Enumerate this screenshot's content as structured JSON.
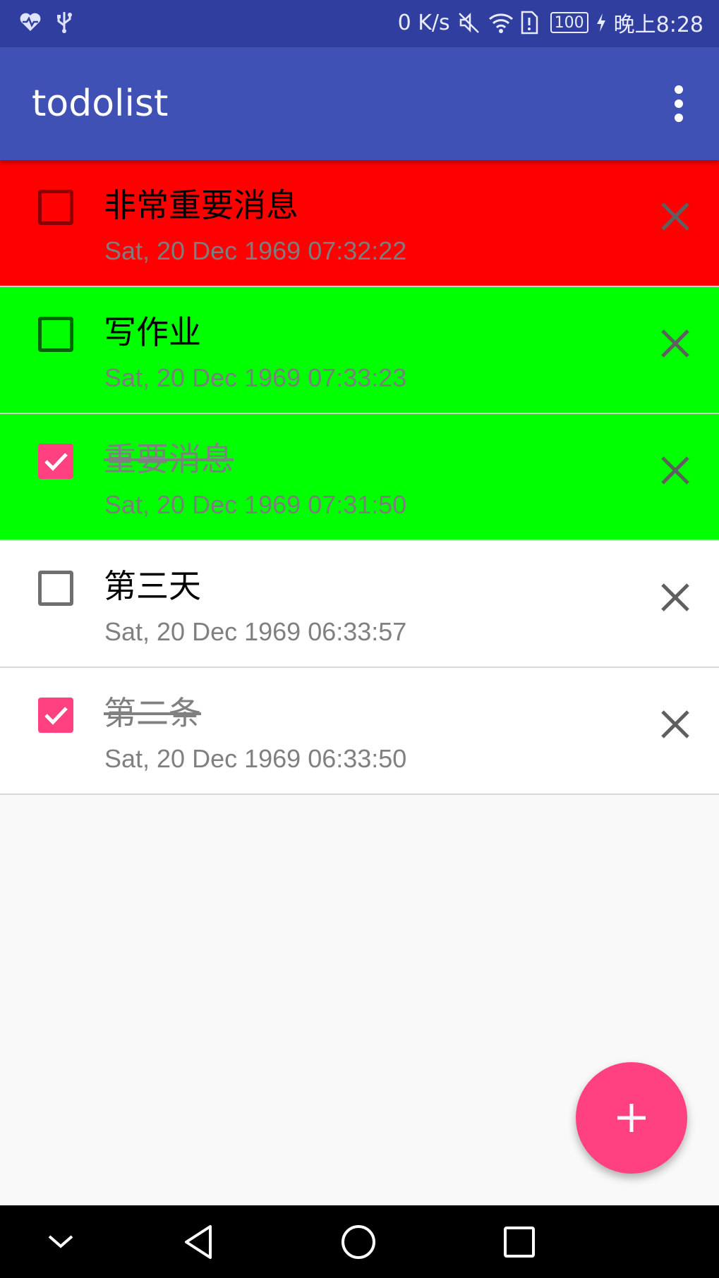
{
  "status_bar": {
    "network_speed": "0 K/s",
    "battery": "100",
    "time": "晚上8:28",
    "icons": [
      "heart-rate-icon",
      "usb-icon",
      "mute-icon",
      "wifi-icon",
      "alert-icon",
      "battery-icon",
      "charging-icon"
    ]
  },
  "app_bar": {
    "title": "todolist",
    "overflow_icon": "more-vert-icon"
  },
  "todos": [
    {
      "title": "非常重要消息",
      "date": "Sat, 20 Dec 1969 07:32:22",
      "done": false,
      "color": "#ff0000"
    },
    {
      "title": "写作业",
      "date": "Sat, 20 Dec 1969 07:33:23",
      "done": false,
      "color": "#00ff00"
    },
    {
      "title": "重要消息",
      "date": "Sat, 20 Dec 1969 07:31:50",
      "done": true,
      "color": "#00ff00"
    },
    {
      "title": "第三天",
      "date": "Sat, 20 Dec 1969 06:33:57",
      "done": false,
      "color": "#ffffff"
    },
    {
      "title": "第二条",
      "date": "Sat, 20 Dec 1969 06:33:50",
      "done": true,
      "color": "#ffffff"
    }
  ],
  "fab": {
    "icon": "add-icon",
    "color": "#ff4081"
  },
  "nav_bar": {
    "icons": [
      "collapse-icon",
      "back-icon",
      "home-icon",
      "recents-icon"
    ]
  },
  "colors": {
    "primary": "#3f51b5",
    "primary_dark": "#303f9f",
    "accent": "#ff4081"
  }
}
